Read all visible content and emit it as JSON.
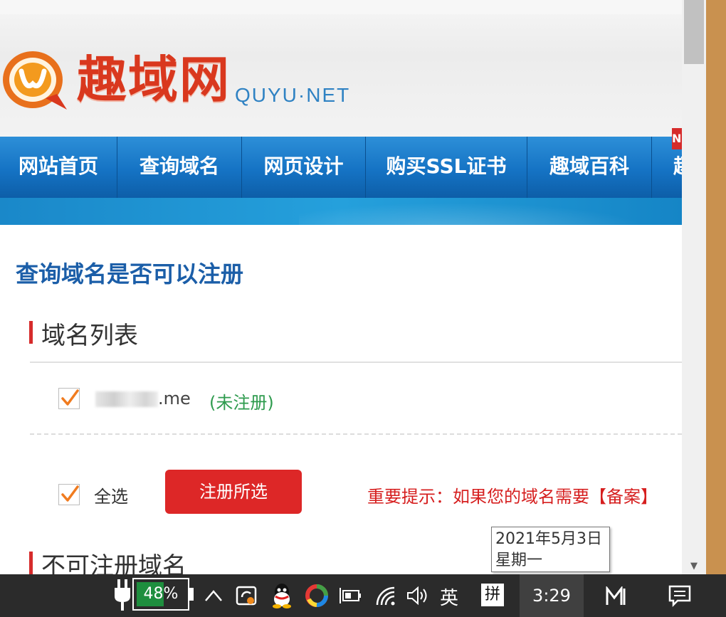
{
  "site": {
    "logo_cn": "趣域网",
    "logo_en": "QUYU·NET",
    "nav_badge": "N",
    "nav": [
      {
        "label": "网站首页"
      },
      {
        "label": "查询域名"
      },
      {
        "label": "网页设计"
      },
      {
        "label": "购买SSL证书"
      },
      {
        "label": "趣域百科"
      },
      {
        "label": "趣"
      }
    ]
  },
  "main": {
    "page_title": "查询域名是否可以注册",
    "list_section_title": "域名列表",
    "domain": {
      "tld_suffix": ".me",
      "status": "(未注册)",
      "checked": true
    },
    "select_all_label": "全选",
    "select_all_checked": true,
    "register_button": "注册所选",
    "notice": "重要提示：如果您的域名需要【备案】",
    "unavailable_section_title": "不可注册域名"
  },
  "tooltip": {
    "date": "2021年5月3日",
    "weekday": "星期一"
  },
  "taskbar": {
    "battery_percent": "48%",
    "ime_lang": "英",
    "ime_mode": "拼",
    "time": "3:29"
  },
  "colors": {
    "brand_blue": "#1573c4",
    "title_blue": "#1b5ea8",
    "accent_red": "#dd2727",
    "status_green": "#2e9b4e",
    "check_orange": "#f07b1f"
  }
}
